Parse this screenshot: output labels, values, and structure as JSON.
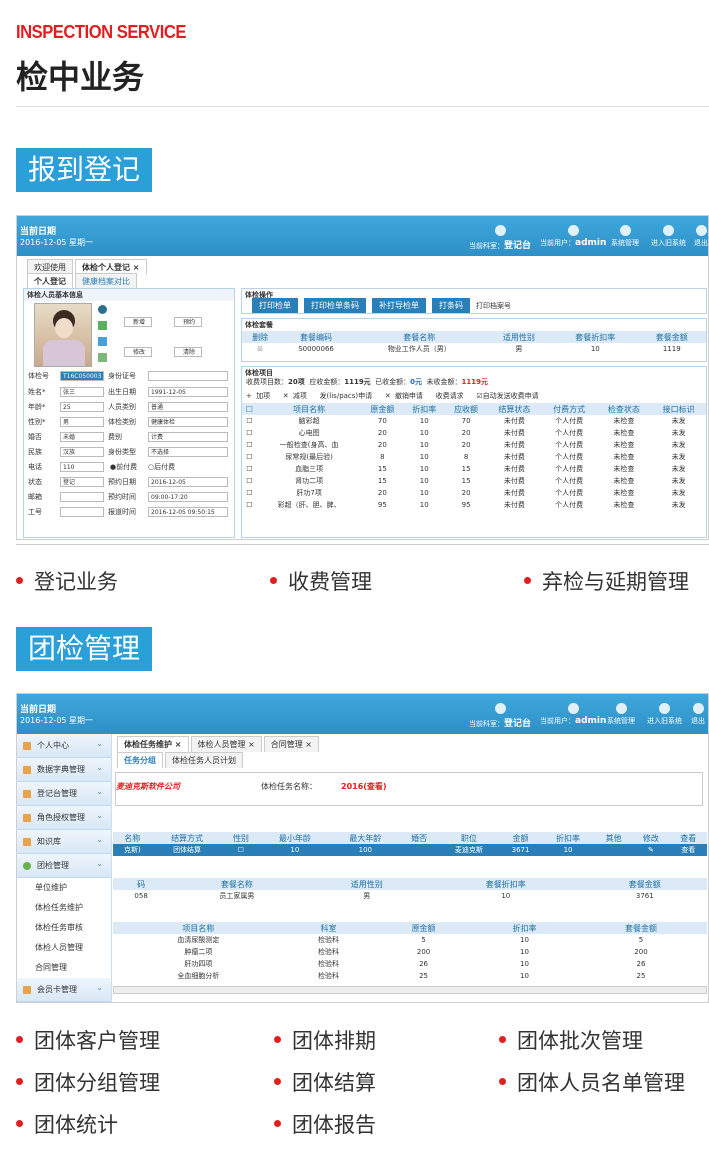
{
  "header": {
    "brand": "INSPECTION SERVICE",
    "title": "检中业务"
  },
  "sections": [
    {
      "label": "报到登记"
    },
    {
      "label": "团检管理"
    }
  ],
  "app1": {
    "date_label": "当前日期",
    "date_value": "2016-12-05 星期一",
    "dept_label": "当前科室：",
    "dept_value": "登记台",
    "user_label": "当前用户：",
    "user_value": "admin",
    "sys_btn": "系统管理",
    "old_btn": "进入旧系统",
    "exit_btn": "退出",
    "tabs": [
      "欢迎使用",
      "体检个人登记 ×"
    ],
    "subtabs": [
      "个人登记",
      "健康档案对比"
    ],
    "basic_title": "体检人员基本信息",
    "btn_add": "新增",
    "btn_appt": "预约",
    "btn_edit": "修改",
    "btn_clear": "清除",
    "form": {
      "f_exam_no": "体检号",
      "v_exam_no": "T16C050003",
      "f_id": "身份证号",
      "f_name": "姓名*",
      "v_name": "张三",
      "f_birth": "出生日期",
      "v_birth": "1991-12-05",
      "f_age": "年龄*",
      "v_age": "25",
      "f_ptype": "人员类别",
      "v_ptype": "普通",
      "f_sex": "性别*",
      "v_sex": "男",
      "f_etype": "体检类别",
      "v_etype": "健康体检",
      "f_mar": "婚否",
      "v_mar": "未婚",
      "f_fee": "费别",
      "v_fee": "计费",
      "f_nation": "民族",
      "v_nation": "汉族",
      "f_idtype": "身份类型",
      "v_idtype": "不选择",
      "f_tel": "电话",
      "v_tel": "110",
      "r_pre": "●前付费",
      "r_post": "○后付费",
      "f_status": "状态",
      "v_status": "登记",
      "f_appt_date": "预约日期",
      "v_appt_date": "2016-12-05",
      "f_mail": "邮箱",
      "f_appt_time": "预约时间",
      "v_appt_time": "09:00-17:20",
      "f_job": "工号",
      "f_reg_date": "报道时间",
      "v_reg_date": "2016-12-05 09:50:15"
    },
    "ops_title": "体检操作",
    "ops": [
      "打印检单",
      "打印检单条码",
      "补打导检单",
      "打条码"
    ],
    "ops_check": "打印档案号",
    "pkg_title": "体检套餐",
    "pkg_headers": [
      "删除",
      "套餐编码",
      "套餐名称",
      "适用性别",
      "套餐折扣率",
      "套餐金额"
    ],
    "pkg_rows": [
      [
        "",
        "S0000066",
        "物业工作人员（男）",
        "男",
        "10",
        "1119"
      ]
    ],
    "item_title": "体检项目",
    "summary": {
      "count_l": "收费项目数：",
      "count_v": "20项",
      "due_l": "应收金额：",
      "due_v": "1119元",
      "paid_l": "已收金额：",
      "paid_v": "0元",
      "unpaid_l": "未收金额：",
      "unpaid_v": "1119元"
    },
    "toolbar": [
      "+ 加项",
      "✕ 减项",
      "发(lis/pacs)申请",
      "✕ 撤销申请",
      "收费请求",
      "☑自动发送收费申请"
    ],
    "item_headers": [
      "",
      "项目名称",
      "原金额",
      "折扣率",
      "应收额",
      "结算状态",
      "付费方式",
      "检查状态",
      "接口标识"
    ],
    "item_rows": [
      [
        "",
        "脑彩超",
        "70",
        "10",
        "70",
        "未付费",
        "个人付费",
        "未检查",
        "未发"
      ],
      [
        "",
        "心电图",
        "20",
        "10",
        "20",
        "未付费",
        "个人付费",
        "未检查",
        "未发"
      ],
      [
        "",
        "一般检查(身高、血",
        "20",
        "10",
        "20",
        "未付费",
        "个人付费",
        "未检查",
        "未发"
      ],
      [
        "",
        "尿常规(最后验)",
        "8",
        "10",
        "8",
        "未付费",
        "个人付费",
        "未检查",
        "未发"
      ],
      [
        "",
        "血脂三项",
        "15",
        "10",
        "15",
        "未付费",
        "个人付费",
        "未检查",
        "未发"
      ],
      [
        "",
        "肾功二项",
        "15",
        "10",
        "15",
        "未付费",
        "个人付费",
        "未检查",
        "未发"
      ],
      [
        "",
        "肝功7项",
        "20",
        "10",
        "20",
        "未付费",
        "个人付费",
        "未检查",
        "未发"
      ],
      [
        "",
        "彩超（肝、胆、脾、",
        "95",
        "10",
        "95",
        "未付费",
        "个人付费",
        "未检查",
        "未发"
      ]
    ]
  },
  "bullets1": [
    "登记业务",
    "收费管理",
    "弃检与延期管理"
  ],
  "app2": {
    "date_label": "当前日期",
    "date_value": "2016-12-05 星期一",
    "dept_label": "当前科室：",
    "dept_value": "登记台",
    "user_label": "当前用户：",
    "user_value": "admin",
    "sys_btn": "系统管理",
    "old_btn": "进入旧系统",
    "exit_btn": "退出",
    "sidebar": [
      "个人中心",
      "数据字典管理",
      "登记台管理",
      "角色授权管理",
      "知识库",
      "团检管理"
    ],
    "sidebar_sub": [
      "单位维护",
      "体检任务维护",
      "体检任务审核",
      "体检人员管理",
      "合同管理"
    ],
    "sidebar_last": "会员卡管理",
    "tabs": [
      "体检任务维护 ×",
      "体检人员管理 ×",
      "合同管理 ×"
    ],
    "subtabs": [
      "任务分组",
      "体检任务人员计划"
    ],
    "company": "麦迪克斯软件公司",
    "task_label": "体检任务名称：",
    "task_value": "2016(查看)",
    "grp_headers": [
      "名称",
      "结算方式",
      "性别",
      "最小年龄",
      "最大年龄",
      "婚否",
      "职位",
      "金额",
      "折扣率",
      "其他",
      "修改",
      "查看"
    ],
    "grp_row": [
      "克斯)",
      "团体结算",
      "",
      "10",
      "100",
      "",
      "麦迪克斯",
      "3671",
      "10",
      "",
      "",
      "查看"
    ],
    "pkg_headers": [
      "码",
      "套餐名称",
      "适用性别",
      "套餐折扣率",
      "套餐金额"
    ],
    "pkg_row": [
      "058",
      "员工家属男",
      "男",
      "10",
      "3761"
    ],
    "item_headers": [
      "项目名称",
      "科室",
      "原金额",
      "折扣率",
      "套餐金额"
    ],
    "item_rows": [
      [
        "血清尿酸测定",
        "检验科",
        "5",
        "10",
        "5"
      ],
      [
        "肿瘤二项",
        "检验科",
        "200",
        "10",
        "200"
      ],
      [
        "肝功四项",
        "检验科",
        "26",
        "10",
        "26"
      ],
      [
        "全血细胞分析",
        "检验科",
        "25",
        "10",
        "25"
      ]
    ]
  },
  "bullets2": [
    "团体客户管理",
    "团体排期",
    "团体批次管理",
    "团体分组管理",
    "团体结算",
    "团体人员名单管理",
    "团体统计",
    "团体报告"
  ]
}
